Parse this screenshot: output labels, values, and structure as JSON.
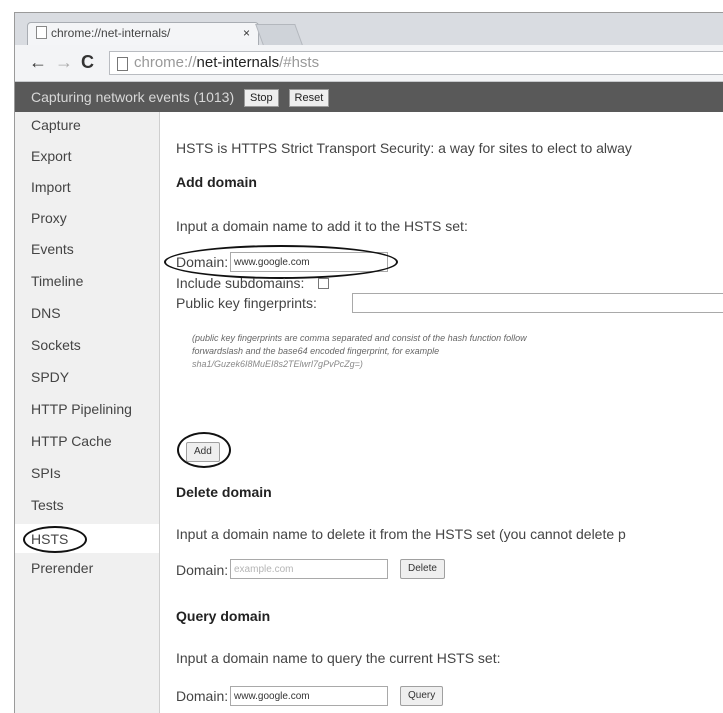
{
  "tab": {
    "title": "chrome://net-internals/",
    "close": "×"
  },
  "toolbar": {
    "back": "←",
    "forward": "→",
    "reload": "C",
    "url_scheme": "chrome://",
    "url_host": "net-internals",
    "url_path": "/#hsts"
  },
  "capture_bar": {
    "text": "Capturing network events (1013)",
    "stop": "Stop",
    "reset": "Reset"
  },
  "sidebar": {
    "items": [
      {
        "label": "Capture"
      },
      {
        "label": "Export"
      },
      {
        "label": "Import"
      },
      {
        "label": "Proxy"
      },
      {
        "label": "Events"
      },
      {
        "label": "Timeline"
      },
      {
        "label": "DNS"
      },
      {
        "label": "Sockets"
      },
      {
        "label": "SPDY"
      },
      {
        "label": "HTTP Pipelining"
      },
      {
        "label": "HTTP Cache"
      },
      {
        "label": "SPIs"
      },
      {
        "label": "Tests"
      },
      {
        "label": "HSTS"
      },
      {
        "label": "Prerender"
      }
    ],
    "active": "HSTS"
  },
  "main": {
    "intro": "HSTS is HTTPS Strict Transport Security: a way for sites to elect to alway",
    "add": {
      "heading": "Add domain",
      "desc": "Input a domain name to add it to the HSTS set:",
      "domain_label": "Domain:",
      "domain_value": "www.google.com",
      "subdomains_label": "Include subdomains:",
      "pins_label": "Public key fingerprints:",
      "note_line1": "(public key fingerprints are comma separated and consist of the hash function follow",
      "note_line2": "forwardslash and the base64 encoded fingerprint, for example",
      "note_line3": "sha1/Guzek6I8MuEI8s2TElwrl7gPvPcZg=)",
      "button": "Add"
    },
    "delete": {
      "heading": "Delete domain",
      "desc": "Input a domain name to delete it from the HSTS set (you cannot delete p",
      "domain_label": "Domain:",
      "placeholder": "example.com",
      "button": "Delete"
    },
    "query": {
      "heading": "Query domain",
      "desc": "Input a domain name to query the current HSTS set:",
      "domain_label": "Domain:",
      "domain_value": "www.google.com",
      "button": "Query"
    }
  }
}
